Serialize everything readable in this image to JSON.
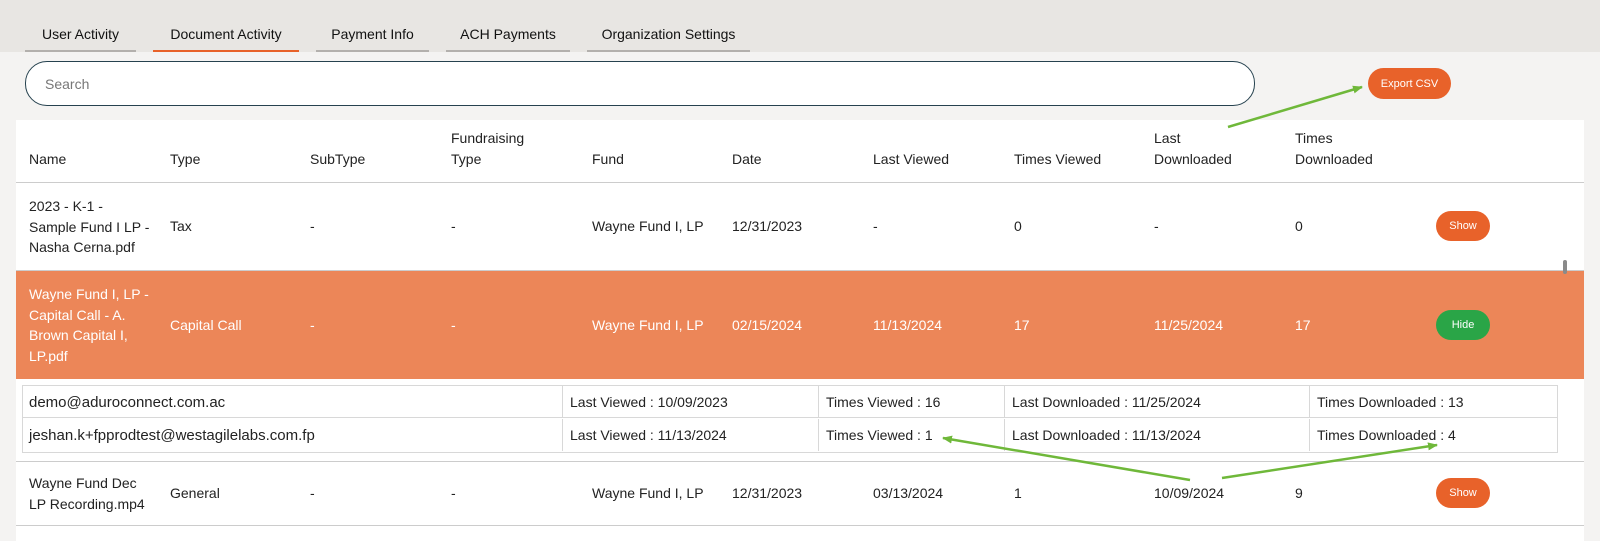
{
  "tabs": [
    {
      "label": "User Activity"
    },
    {
      "label": "Document Activity"
    },
    {
      "label": "Payment Info"
    },
    {
      "label": "ACH Payments"
    },
    {
      "label": "Organization Settings"
    }
  ],
  "active_tab": "Document Activity",
  "search": {
    "placeholder": "Search",
    "value": ""
  },
  "export_label": "Export CSV",
  "columns": [
    "Name",
    "Type",
    "SubType",
    "Fundraising\nType",
    "Fund",
    "Date",
    "Last Viewed",
    "Times Viewed",
    "Last\nDownloaded",
    "Times\nDownloaded"
  ],
  "rows": [
    {
      "name": "2023 - K-1 -\nSample Fund I LP -\nNasha Cerna.pdf",
      "type": "Tax",
      "subtype": "-",
      "fundraising_type": "-",
      "fund": "Wayne Fund I, LP",
      "date": "12/31/2023",
      "last_viewed": "-",
      "times_viewed": "0",
      "last_downloaded": "-",
      "times_downloaded": "0",
      "action": "Show"
    },
    {
      "name": "Wayne Fund I, LP -\nCapital Call - A.\nBrown Capital I,\nLP.pdf",
      "type": "Capital Call",
      "subtype": "-",
      "fundraising_type": "-",
      "fund": "Wayne Fund I, LP",
      "date": "02/15/2024",
      "last_viewed": "11/13/2024",
      "times_viewed": "17",
      "last_downloaded": "11/25/2024",
      "times_downloaded": "17",
      "action": "Hide"
    },
    {
      "name": "Wayne Fund Dec\nLP Recording.mp4",
      "type": "General",
      "subtype": "-",
      "fundraising_type": "-",
      "fund": "Wayne Fund I, LP",
      "date": "12/31/2023",
      "last_viewed": "03/13/2024",
      "times_viewed": "1",
      "last_downloaded": "10/09/2024",
      "times_downloaded": "9",
      "action": "Show"
    }
  ],
  "expanded_details": [
    {
      "email": "demo@aduroconnect.com.ac",
      "last_viewed": "Last Viewed : 10/09/2023",
      "times_viewed": "Times Viewed : 16",
      "last_downloaded": "Last Downloaded : 11/25/2024",
      "times_downloaded": "Times Downloaded : 13"
    },
    {
      "email": "jeshan.k+fpprodtest@westagilelabs.com.fp",
      "last_viewed": "Last Viewed : 11/13/2024",
      "times_viewed": "Times Viewed : 1",
      "last_downloaded": "Last Downloaded : 11/13/2024",
      "times_downloaded": "Times Downloaded : 4"
    }
  ],
  "colors": {
    "accent": "#e8622a",
    "row_highlight": "#ec8658",
    "hide_button": "#2aa547",
    "annotation_arrow": "#6fb83a",
    "search_border": "#26424f"
  }
}
